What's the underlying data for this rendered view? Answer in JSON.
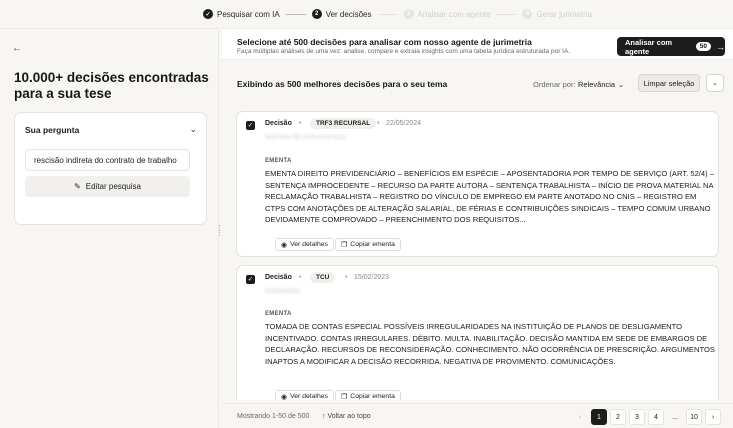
{
  "stepper": {
    "steps": [
      {
        "label": "Pesquisar com IA",
        "state": "done"
      },
      {
        "label": "Ver decisões",
        "state": "active",
        "number": "2"
      },
      {
        "label": "Analisar com agente",
        "state": "pending",
        "number": "3"
      },
      {
        "label": "Gerar jurimetria",
        "state": "pending",
        "number": "4"
      }
    ]
  },
  "left": {
    "title": "10.000+ decisões encontradas para a sua tese",
    "question": {
      "heading": "Sua pergunta",
      "value": "rescisão indireta do contrato de trabalho",
      "edit_label": "Editar pesquisa"
    }
  },
  "banner": {
    "title": "Selecione até 500 decisões para analisar com nosso agente de jurimetria",
    "subtitle": "Faça múltiplas análises de uma vez: analise, compare e extraia insights com uma tabela jurídica estruturada por IA.",
    "button_label": "Analisar com agente",
    "button_badge": "50"
  },
  "toolbar": {
    "title": "Exibindo as 500 melhores decisões para o seu tema",
    "order_label": "Ordenar por:",
    "order_value": "Relevância",
    "clear_label": "Limpar seleção"
  },
  "cards": [
    {
      "checked": true,
      "kind": "Decisão",
      "court": "TRF3 RECURSAL",
      "date": "22/05/2024",
      "process": "5007541-09.2024.4.03.6311",
      "ementa_label": "EMENTA",
      "ementa": "EMENTA DIREITO PREVIDENCIÁRIO – BENEFÍCIOS EM ESPÉCIE – APOSENTADORIA POR TEMPO DE SERVIÇO (ART. 52/4) – SENTENÇA IMPROCEDENTE – RECURSO DA PARTE AUTORA – SENTENÇA TRABALHISTA – INÍCIO DE PROVA MATERIAL NA RECLAMAÇÃO TRABALHISTA – REGISTRO DO VÍNCULO DE EMPREGO EM PARTE ANOTADO NO CNIS – REGISTRO EM CTPS COM ANOTAÇÕES DE ALTERAÇÃO SALARIAL, DE FÉRIAS E CONTRIBUIÇÕES SINDICAIS – TEMPO COMUM URBANO DEVIDAMENTE COMPROVADO – PREENCHIMENTO DOS REQUISITOS...",
      "details_label": "Ver detalhes",
      "copy_label": "Copiar ementa"
    },
    {
      "checked": true,
      "kind": "Decisão",
      "court": "TCU",
      "date": "15/02/2023",
      "process": "02029/2023",
      "ementa_label": "EMENTA",
      "ementa": "TOMADA DE CONTAS ESPECIAL POSSÍVEIS IRREGULARIDADES NA INSTITUIÇÃO DE PLANOS DE DESLIGAMENTO INCENTIVADO. CONTAS IRREGULARES. DÉBITO. MULTA. INABILITAÇÃO. DECISÃO MANTIDA EM SEDE DE EMBARGOS DE DECLARAÇÃO. RECURSOS DE RECONSIDERAÇÃO. CONHECIMENTO. NÃO OCORRÊNCIA DE PRESCRIÇÃO. ARGUMENTOS INAPTOS A MODIFICAR A DECISÃO RECORRIDA. NEGATIVA DE PROVIMENTO. COMUNICAÇÕES.",
      "details_label": "Ver detalhes",
      "copy_label": "Copiar ementa"
    }
  ],
  "footer": {
    "showing": "Mostrando 1-50 de 500",
    "back_top": "Voltar ao topo",
    "pages": [
      "1",
      "2",
      "3",
      "4",
      "...",
      "10"
    ],
    "active_page": "1"
  },
  "icons": {
    "back": "arrow-left-icon",
    "check": "check-icon",
    "chevron": "chevron-down-icon",
    "pencil": "pencil-icon",
    "eye": "eye-icon",
    "copy": "copy-icon",
    "arrow_up": "arrow-up-icon",
    "arrow_right": "arrow-right-icon",
    "prev": "chevron-left-icon",
    "next": "chevron-right-icon"
  }
}
